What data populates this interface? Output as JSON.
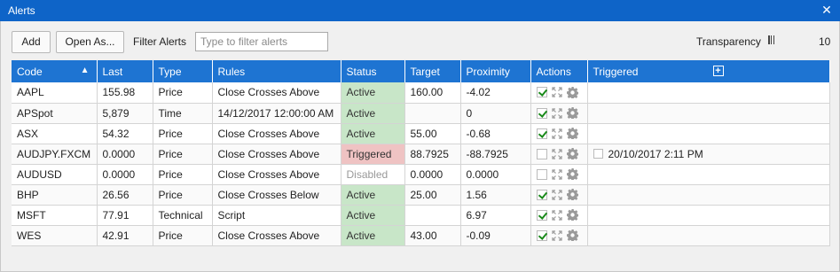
{
  "window": {
    "title": "Alerts",
    "close_icon": "close-icon"
  },
  "toolbar": {
    "add_label": "Add",
    "open_as_label": "Open As...",
    "filter_label": "Filter Alerts",
    "filter_placeholder": "Type to filter alerts",
    "filter_value": "",
    "transparency_label": "Transparency",
    "transparency_value": "10"
  },
  "columns": [
    "Code",
    "Last",
    "Type",
    "Rules",
    "Status",
    "Target",
    "Proximity",
    "Actions",
    "Triggered"
  ],
  "rows": [
    {
      "code": "AAPL",
      "last": "155.98",
      "type": "Price",
      "rules": "Close Crosses Above",
      "status": "Active",
      "target": "160.00",
      "proximity": "-4.02",
      "enabled": true,
      "triggered": ""
    },
    {
      "code": "APSpot",
      "last": "5,879",
      "type": "Time",
      "rules": "14/12/2017 12:00:00 AM",
      "status": "Active",
      "target": "",
      "proximity": "0",
      "enabled": true,
      "triggered": ""
    },
    {
      "code": "ASX",
      "last": "54.32",
      "type": "Price",
      "rules": "Close Crosses Above",
      "status": "Active",
      "target": "55.00",
      "proximity": "-0.68",
      "enabled": true,
      "triggered": ""
    },
    {
      "code": "AUDJPY.FXCM",
      "last": "0.0000",
      "type": "Price",
      "rules": "Close Crosses Above",
      "status": "Triggered",
      "target": "88.7925",
      "proximity": "-88.7925",
      "enabled": false,
      "triggered": "20/10/2017 2:11 PM"
    },
    {
      "code": "AUDUSD",
      "last": "0.0000",
      "type": "Price",
      "rules": "Close Crosses Above",
      "status": "Disabled",
      "target": "0.0000",
      "proximity": "0.0000",
      "enabled": false,
      "triggered": ""
    },
    {
      "code": "BHP",
      "last": "26.56",
      "type": "Price",
      "rules": "Close Crosses Below",
      "status": "Active",
      "target": "25.00",
      "proximity": "1.56",
      "enabled": true,
      "triggered": ""
    },
    {
      "code": "MSFT",
      "last": "77.91",
      "type": "Technical",
      "rules": "Script",
      "status": "Active",
      "target": "",
      "proximity": "6.97",
      "enabled": true,
      "triggered": ""
    },
    {
      "code": "WES",
      "last": "42.91",
      "type": "Price",
      "rules": "Close Crosses Above",
      "status": "Active",
      "target": "43.00",
      "proximity": "-0.09",
      "enabled": true,
      "triggered": ""
    }
  ],
  "colors": {
    "titlebar": "#0e64c8",
    "header": "#1e74d2",
    "active": "#c8e6c8",
    "triggered": "#efc3c3",
    "check": "#1a8a1a"
  }
}
